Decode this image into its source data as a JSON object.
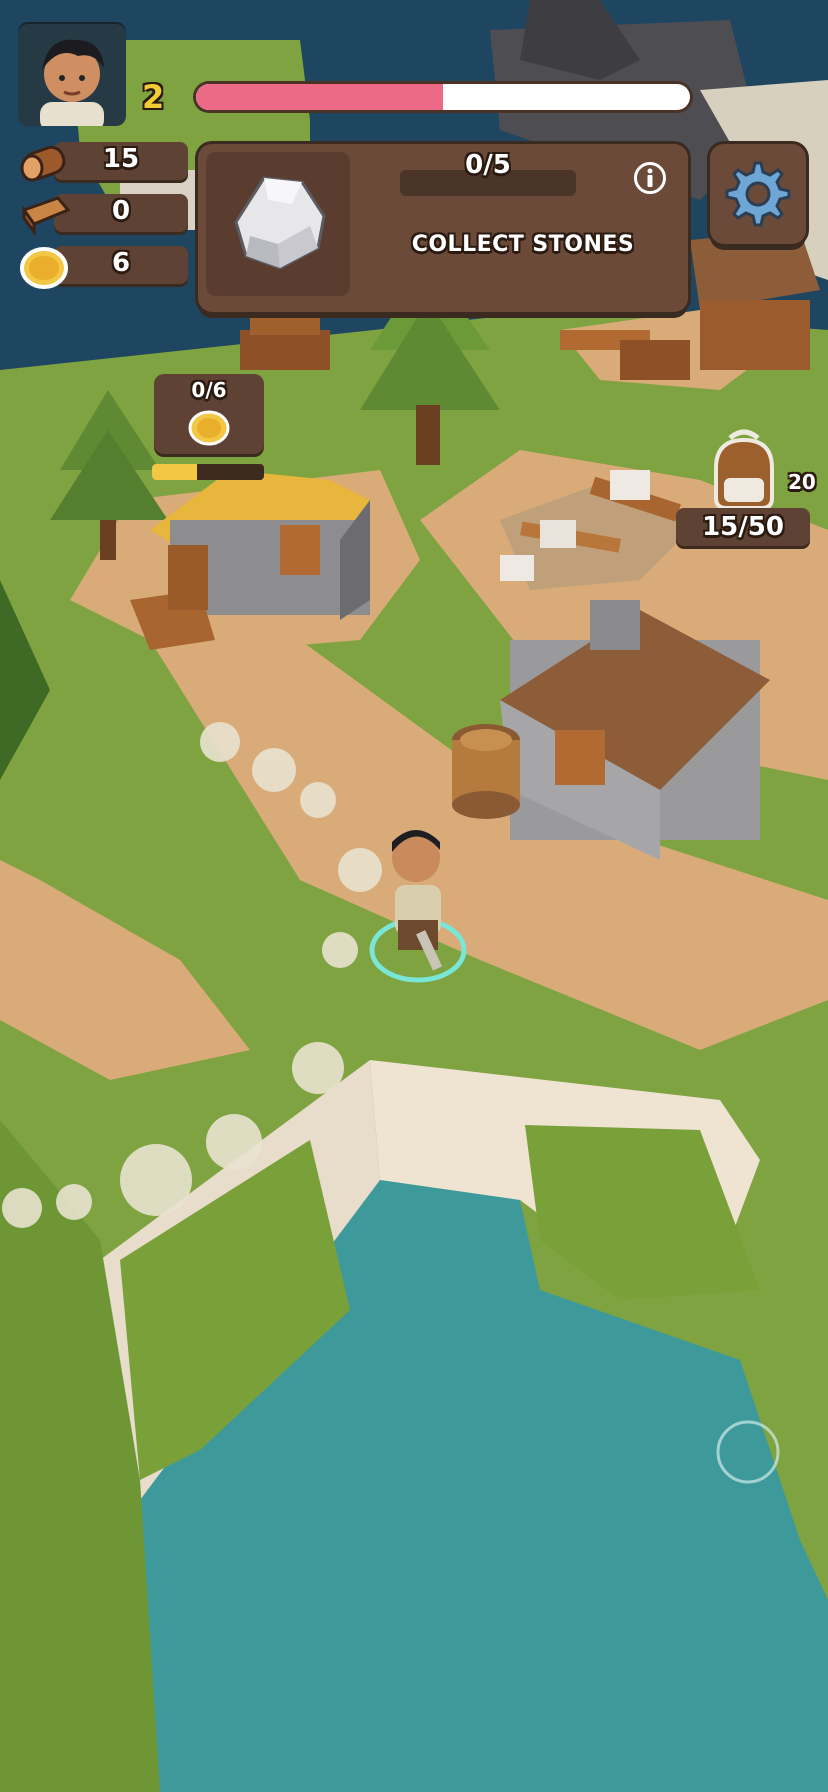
{
  "player": {
    "level": "2",
    "xp_fraction": 0.5
  },
  "resources": [
    {
      "name": "logs",
      "icon": "log-icon",
      "value": "15"
    },
    {
      "name": "planks",
      "icon": "plank-icon",
      "value": "0"
    },
    {
      "name": "coins",
      "icon": "coin-icon",
      "value": "6"
    }
  ],
  "quest": {
    "progress": "0/5",
    "title": "COLLECT STONES",
    "icon": "stone-icon"
  },
  "building": {
    "coins_progress": "0/6",
    "build_fraction": 0.4
  },
  "backpack": {
    "capacity": "15/50",
    "side_value": "20"
  },
  "colors": {
    "grass": "#7fa341",
    "path": "#d8ab78",
    "water": "#3e9a9a",
    "xp": "#ec6a85",
    "panel": "#6b4a3a"
  }
}
